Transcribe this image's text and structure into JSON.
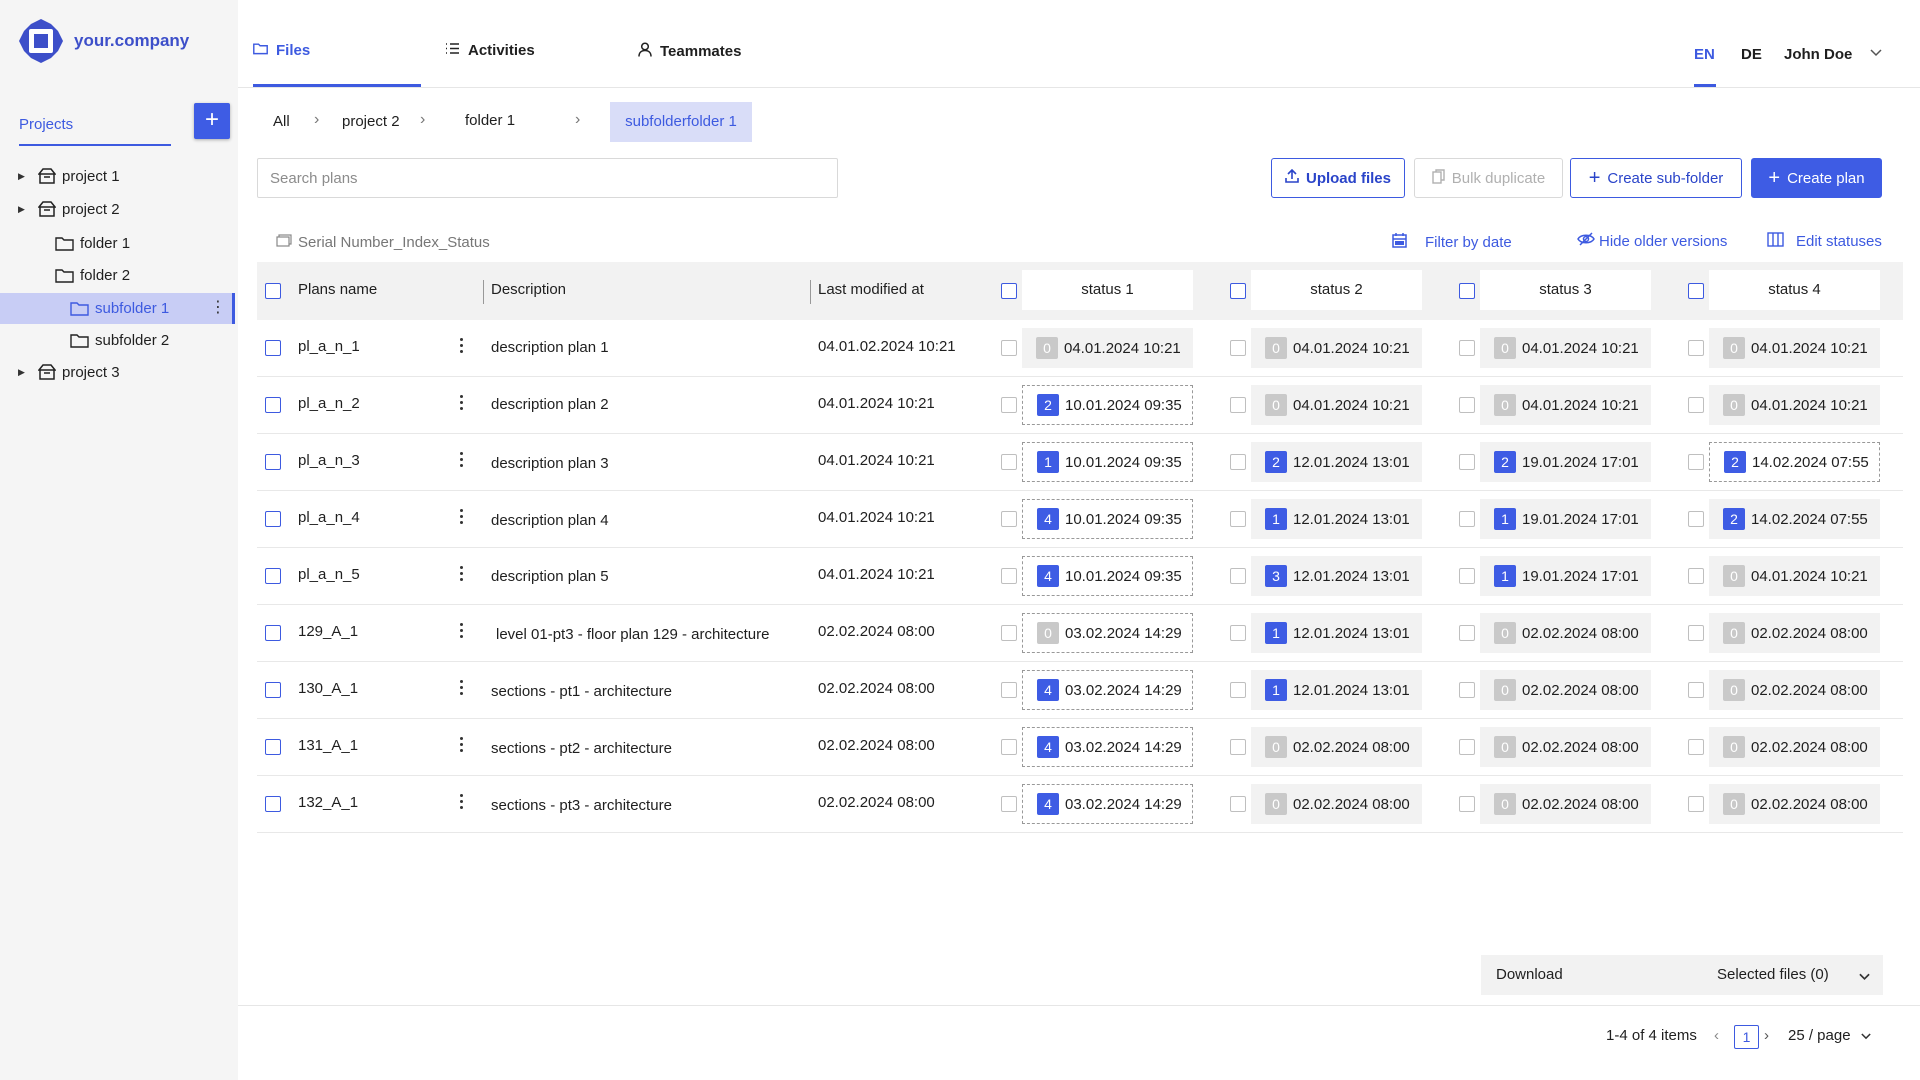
{
  "brand": {
    "name": "your.company"
  },
  "sidebar": {
    "projects_label": "Projects",
    "add_label": "+",
    "tree": [
      {
        "label": "project 1"
      },
      {
        "label": "project 2"
      },
      {
        "label": "folder 1"
      },
      {
        "label": "folder 2"
      },
      {
        "label": "subfolder 1"
      },
      {
        "label": "subfolder 2"
      },
      {
        "label": "project 3"
      }
    ]
  },
  "nav": {
    "tabs": [
      {
        "label": "Files"
      },
      {
        "label": "Activities"
      },
      {
        "label": "Teammates"
      }
    ],
    "lang_en": "EN",
    "lang_de": "DE",
    "user": "John  Doe"
  },
  "breadcrumb": {
    "items": [
      "All",
      "project 2",
      "folder 1",
      "subfolderfolder 1"
    ]
  },
  "search": {
    "placeholder": "Search plans"
  },
  "actions": {
    "upload": "Upload files",
    "bulk": "Bulk duplicate",
    "subfolder": "Create sub-folder",
    "plan": "Create plan"
  },
  "toolbar": {
    "naming": "Serial Number_Index_Status",
    "filter": "Filter by date",
    "hide": "Hide older versions",
    "edit": "Edit statuses"
  },
  "table": {
    "headers": {
      "name": "Plans name",
      "description": "Description",
      "modified": "Last modified at",
      "status1": "status 1",
      "status2": "status 2",
      "status3": "status 3",
      "status4": "status 4"
    },
    "rows": [
      {
        "name": "pl_a_n_1",
        "description": "description plan 1",
        "modified": "04.01.02.2024 10:21",
        "s": [
          {
            "n": "0",
            "d": "04.01.2024 10:21",
            "blue": false,
            "dashed": false
          },
          {
            "n": "0",
            "d": "04.01.2024 10:21",
            "blue": false,
            "dashed": false
          },
          {
            "n": "0",
            "d": "04.01.2024 10:21",
            "blue": false,
            "dashed": false
          },
          {
            "n": "0",
            "d": "04.01.2024 10:21",
            "blue": false,
            "dashed": false
          }
        ]
      },
      {
        "name": "pl_a_n_2",
        "description": "description plan 2",
        "modified": "04.01.2024 10:21",
        "s": [
          {
            "n": "2",
            "d": "10.01.2024 09:35",
            "blue": true,
            "dashed": true
          },
          {
            "n": "0",
            "d": "04.01.2024 10:21",
            "blue": false,
            "dashed": false
          },
          {
            "n": "0",
            "d": "04.01.2024 10:21",
            "blue": false,
            "dashed": false
          },
          {
            "n": "0",
            "d": "04.01.2024 10:21",
            "blue": false,
            "dashed": false
          }
        ]
      },
      {
        "name": "pl_a_n_3",
        "description": "description plan 3",
        "modified": "04.01.2024 10:21",
        "s": [
          {
            "n": "1",
            "d": "10.01.2024 09:35",
            "blue": true,
            "dashed": true
          },
          {
            "n": "2",
            "d": "12.01.2024 13:01",
            "blue": true,
            "dashed": false
          },
          {
            "n": "2",
            "d": "19.01.2024 17:01",
            "blue": true,
            "dashed": false
          },
          {
            "n": "2",
            "d": "14.02.2024 07:55",
            "blue": true,
            "dashed": true
          }
        ]
      },
      {
        "name": "pl_a_n_4",
        "description": "description plan 4",
        "modified": "04.01.2024 10:21",
        "s": [
          {
            "n": "4",
            "d": "10.01.2024 09:35",
            "blue": true,
            "dashed": true
          },
          {
            "n": "1",
            "d": "12.01.2024 13:01",
            "blue": true,
            "dashed": false
          },
          {
            "n": "1",
            "d": "19.01.2024 17:01",
            "blue": true,
            "dashed": false
          },
          {
            "n": "2",
            "d": "14.02.2024 07:55",
            "blue": true,
            "dashed": false
          }
        ]
      },
      {
        "name": "pl_a_n_5",
        "description": "description plan 5",
        "modified": "04.01.2024 10:21",
        "s": [
          {
            "n": "4",
            "d": "10.01.2024 09:35",
            "blue": true,
            "dashed": true
          },
          {
            "n": "3",
            "d": "12.01.2024 13:01",
            "blue": true,
            "dashed": false
          },
          {
            "n": "1",
            "d": "19.01.2024 17:01",
            "blue": true,
            "dashed": false
          },
          {
            "n": "0",
            "d": "04.01.2024 10:21",
            "blue": false,
            "dashed": false
          }
        ]
      },
      {
        "name": "129_A_1",
        "description": "level 01-pt3 - floor plan 129 - architecture",
        "modified": "02.02.2024 08:00",
        "s": [
          {
            "n": "0",
            "d": "03.02.2024 14:29",
            "blue": false,
            "dashed": true
          },
          {
            "n": "1",
            "d": "12.01.2024 13:01",
            "blue": true,
            "dashed": false
          },
          {
            "n": "0",
            "d": "02.02.2024 08:00",
            "blue": false,
            "dashed": false
          },
          {
            "n": "0",
            "d": "02.02.2024 08:00",
            "blue": false,
            "dashed": false
          }
        ]
      },
      {
        "name": "130_A_1",
        "description": "sections - pt1 - architecture",
        "modified": "02.02.2024 08:00",
        "s": [
          {
            "n": "4",
            "d": "03.02.2024 14:29",
            "blue": true,
            "dashed": true
          },
          {
            "n": "1",
            "d": "12.01.2024 13:01",
            "blue": true,
            "dashed": false
          },
          {
            "n": "0",
            "d": "02.02.2024 08:00",
            "blue": false,
            "dashed": false
          },
          {
            "n": "0",
            "d": "02.02.2024 08:00",
            "blue": false,
            "dashed": false
          }
        ]
      },
      {
        "name": "131_A_1",
        "description": "sections - pt2 - architecture",
        "modified": "02.02.2024 08:00",
        "s": [
          {
            "n": "4",
            "d": "03.02.2024 14:29",
            "blue": true,
            "dashed": true
          },
          {
            "n": "0",
            "d": "02.02.2024 08:00",
            "blue": false,
            "dashed": false
          },
          {
            "n": "0",
            "d": "02.02.2024 08:00",
            "blue": false,
            "dashed": false
          },
          {
            "n": "0",
            "d": "02.02.2024 08:00",
            "blue": false,
            "dashed": false
          }
        ]
      },
      {
        "name": "132_A_1",
        "description": "sections - pt3 - architecture",
        "modified": "02.02.2024 08:00",
        "s": [
          {
            "n": "4",
            "d": "03.02.2024 14:29",
            "blue": true,
            "dashed": true
          },
          {
            "n": "0",
            "d": "02.02.2024 08:00",
            "blue": false,
            "dashed": false
          },
          {
            "n": "0",
            "d": "02.02.2024 08:00",
            "blue": false,
            "dashed": false
          },
          {
            "n": "0",
            "d": "02.02.2024 08:00",
            "blue": false,
            "dashed": false
          }
        ]
      }
    ]
  },
  "download": {
    "label": "Download",
    "selected": "Selected files (0)"
  },
  "pagination": {
    "summary": "1-4 of 4 items",
    "page": "1",
    "per_page": "25 / page"
  },
  "colors": {
    "accent": "#3d5ae0",
    "selected_bg": "#c8cdf5"
  },
  "icons": [
    "logo-icon",
    "folder-icon",
    "list-icon",
    "user-icon",
    "chevron-down-icon",
    "chevron-right-icon",
    "upload-icon",
    "copy-icon",
    "plus-icon",
    "calendar-icon",
    "eye-off-icon",
    "columns-icon",
    "tag-icon",
    "archive-icon",
    "kebab-icon"
  ]
}
